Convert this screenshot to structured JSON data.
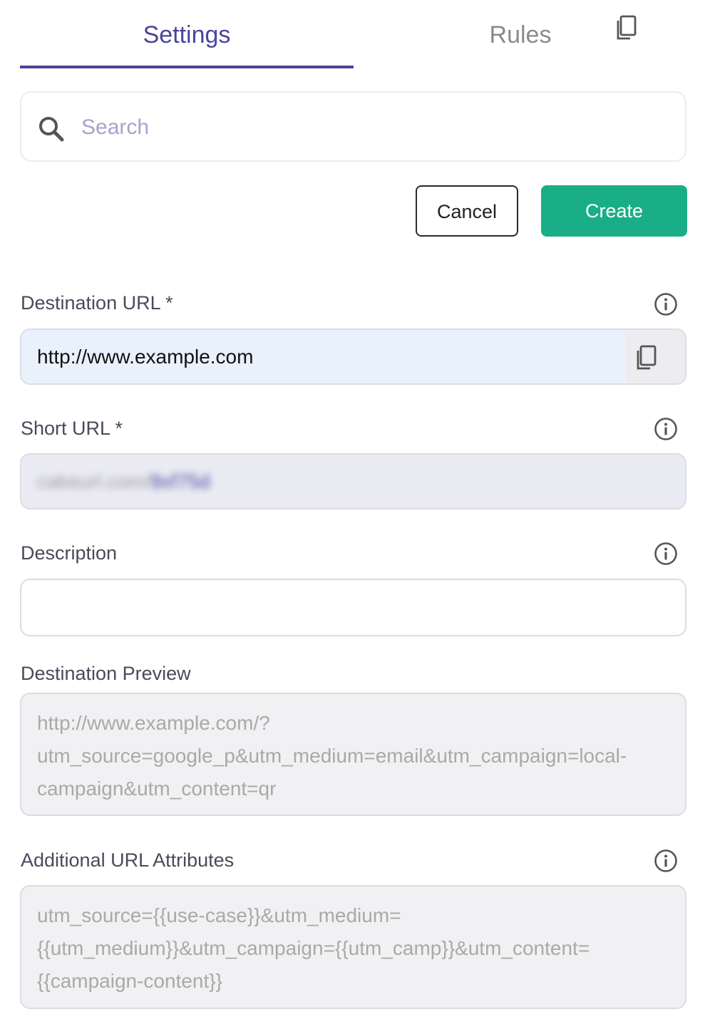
{
  "tabs": [
    {
      "label": "Settings",
      "active": true
    },
    {
      "label": "Rules",
      "active": false
    }
  ],
  "search": {
    "placeholder": "Search",
    "value": "",
    "icon": "search-icon"
  },
  "actions": {
    "cancel_label": "Cancel",
    "create_label": "Create",
    "create_color": "#1aae88"
  },
  "form": {
    "destination_url": {
      "label": "Destination URL *",
      "value": "http://www.example.com"
    },
    "short_url": {
      "label": "Short URL *",
      "value_prefix": "cakeurl.com/",
      "value_slug": "9xf75d"
    },
    "description": {
      "label": "Description",
      "value": ""
    },
    "destination_preview": {
      "label": "Destination Preview",
      "lines": [
        "http://www.example.com/?",
        "utm_source=google_p&utm_medium=email&utm_campaign=local-",
        "campaign&utm_content=qr"
      ]
    },
    "additional_attributes": {
      "label": "Additional URL Attributes",
      "lines": [
        "utm_source={{use-case}}&utm_medium=",
        "{{utm_medium}}&utm_campaign={{utm_camp}}&utm_content=",
        "{{campaign-content}}"
      ]
    }
  },
  "colors": {
    "accent": "#4b4499",
    "create": "#1aae88",
    "dest_field_bg": "#e9f1fd"
  }
}
